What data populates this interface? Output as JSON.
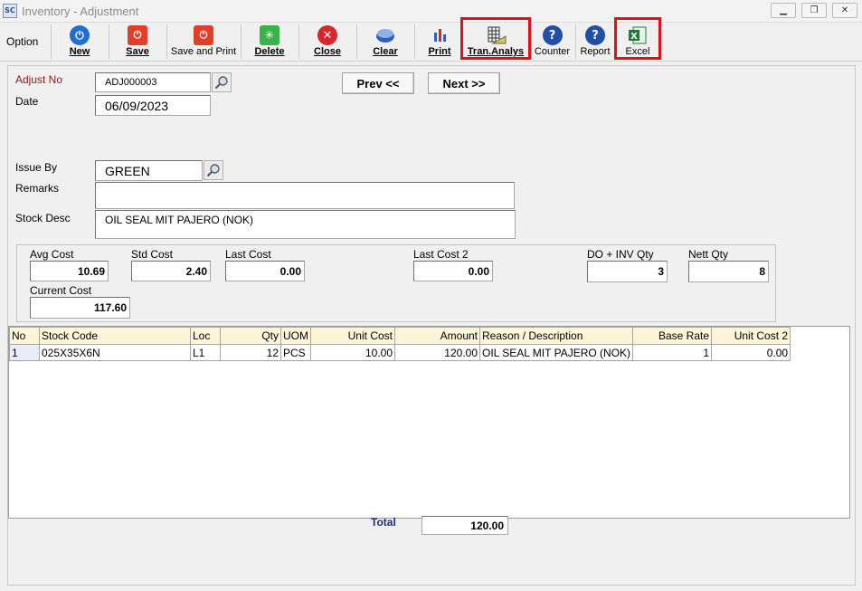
{
  "window": {
    "title": "Inventory - Adjustment",
    "app_icon_text": "SC"
  },
  "toolbar": {
    "option_label": "Option",
    "buttons": [
      {
        "label": "New",
        "icon": "new-icon",
        "color": "#1f6fd0"
      },
      {
        "label": "Save",
        "icon": "save-icon",
        "color": "#e0402a"
      },
      {
        "label": "Save and Print",
        "icon": "save-print-icon",
        "color": "#e0402a"
      },
      {
        "label": "Delete",
        "icon": "delete-icon",
        "color": "#39b24a"
      },
      {
        "label": "Close",
        "icon": "close-icon",
        "color": "#d9262b"
      },
      {
        "label": "Clear",
        "icon": "clear-icon",
        "color": "#2f5fb8"
      },
      {
        "label": "Print",
        "icon": "print-icon",
        "color": "#2f5fb8"
      },
      {
        "label": "Tran.Analys",
        "icon": "tran-analysis-icon",
        "color": "#6a6a3a"
      },
      {
        "label": "Counter",
        "icon": "counter-help-icon",
        "color": "#1f4fa8"
      },
      {
        "label": "Report",
        "icon": "report-help-icon",
        "color": "#1f4fa8"
      },
      {
        "label": "Excel",
        "icon": "excel-icon",
        "color": "#1e7a3a"
      }
    ],
    "highlight_color": "#e0101a"
  },
  "header": {
    "adjust_no_label": "Adjust  No",
    "adjust_no_value": "ADJ000003",
    "date_label": "Date",
    "date_value": "06/09/2023",
    "prev_label": "Prev <<",
    "next_label": "Next >>",
    "issue_by_label": "Issue By",
    "issue_by_value": "GREEN",
    "remarks_label": "Remarks",
    "remarks_value": "",
    "stock_desc_label": "Stock Desc",
    "stock_desc_value": "OIL SEAL MIT PAJERO (NOK)"
  },
  "costs": {
    "avg_cost_label": "Avg Cost",
    "avg_cost": "10.69",
    "std_cost_label": "Std Cost",
    "std_cost": "2.40",
    "last_cost_label": "Last Cost",
    "last_cost": "0.00",
    "last_cost2_label": "Last Cost 2",
    "last_cost2": "0.00",
    "do_inv_qty_label": "DO + INV Qty",
    "do_inv_qty": "3",
    "nett_qty_label": "Nett Qty",
    "nett_qty": "8",
    "current_cost_label": "Current Cost",
    "current_cost": "117.60"
  },
  "grid": {
    "columns": [
      "No",
      "Stock Code",
      "Loc",
      "Qty",
      "UOM",
      "Unit Cost",
      "Amount",
      "Reason / Description",
      "Base Rate",
      "Unit Cost 2"
    ],
    "rows": [
      [
        "1",
        "025X35X6N",
        "L1",
        "12",
        "PCS",
        "10.00",
        "120.00",
        "OIL SEAL MIT PAJERO (NOK)",
        "1",
        "0.00"
      ]
    ]
  },
  "total": {
    "label": "Total",
    "value": "120.00"
  }
}
